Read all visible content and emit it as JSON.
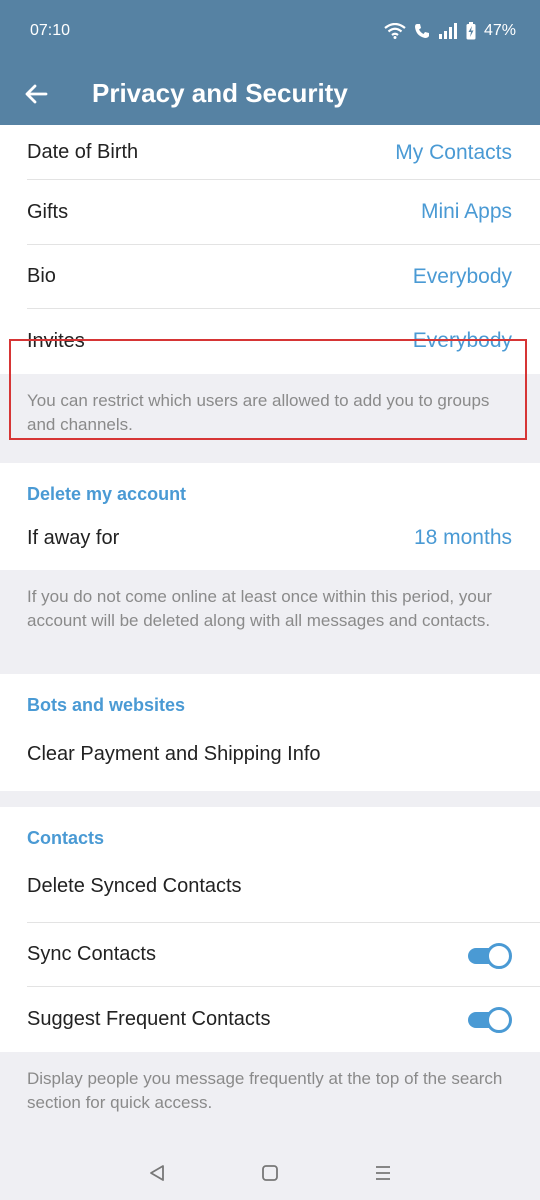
{
  "status": {
    "time": "07:10",
    "battery": "47%"
  },
  "header": {
    "title": "Privacy and Security"
  },
  "privacy_rows": [
    {
      "label": "Date of Birth",
      "value": "My Contacts"
    },
    {
      "label": "Gifts",
      "value": "Mini Apps"
    },
    {
      "label": "Bio",
      "value": "Everybody"
    },
    {
      "label": "Invites",
      "value": "Everybody"
    }
  ],
  "invites_note": "You can restrict which users are allowed to add you to groups and channels.",
  "delete_account": {
    "header": "Delete my account",
    "label": "If away for",
    "value": "18 months",
    "note": "If you do not come online at least once within this period, your account will be deleted along with all messages and contacts."
  },
  "bots": {
    "header": "Bots and websites",
    "clear_label": "Clear Payment and Shipping Info"
  },
  "contacts": {
    "header": "Contacts",
    "delete_synced": "Delete Synced Contacts",
    "sync_label": "Sync Contacts",
    "sync_on": true,
    "suggest_label": "Suggest Frequent Contacts",
    "suggest_on": true,
    "note": "Display people you message frequently at the top of the search section for quick access."
  },
  "colors": {
    "header_bg": "#5682a3",
    "accent": "#4a9ad4",
    "highlight": "#d63535"
  }
}
